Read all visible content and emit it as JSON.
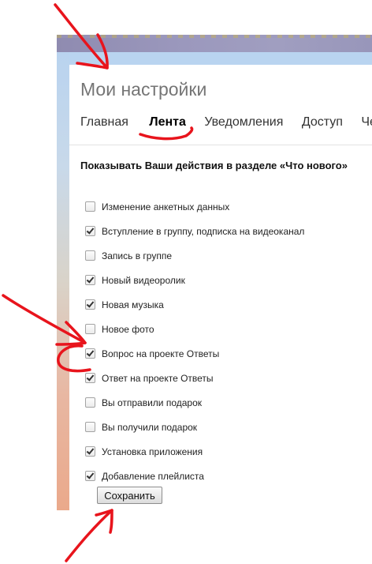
{
  "settings": {
    "title": "Мои настройки",
    "tabs": [
      {
        "label": "Главная",
        "active": false
      },
      {
        "label": "Лента",
        "active": true
      },
      {
        "label": "Уведомления",
        "active": false
      },
      {
        "label": "Доступ",
        "active": false
      },
      {
        "label": "Че",
        "active": false
      }
    ],
    "section_title": "Показывать Ваши действия в разделе «Что нового»",
    "options": [
      {
        "label": "Изменение анкетных данных",
        "checked": false
      },
      {
        "label": "Вступление в группу, подписка на видеоканал",
        "checked": true
      },
      {
        "label": "Запись в группе",
        "checked": false
      },
      {
        "label": "Новый видеоролик",
        "checked": true
      },
      {
        "label": "Новая музыка",
        "checked": true
      },
      {
        "label": "Новое фото",
        "checked": false
      },
      {
        "label": "Вопрос на проекте Ответы",
        "checked": true
      },
      {
        "label": "Ответ на проекте Ответы",
        "checked": true
      },
      {
        "label": "Вы отправили подарок",
        "checked": false
      },
      {
        "label": "Вы получили подарок",
        "checked": false
      },
      {
        "label": "Установка приложения",
        "checked": true
      },
      {
        "label": "Добавление плейлиста",
        "checked": true
      }
    ],
    "save_label": "Сохранить"
  },
  "colors": {
    "annotation": "#e8141c",
    "header_band": "#b9d4f0",
    "title_text": "#757575"
  }
}
